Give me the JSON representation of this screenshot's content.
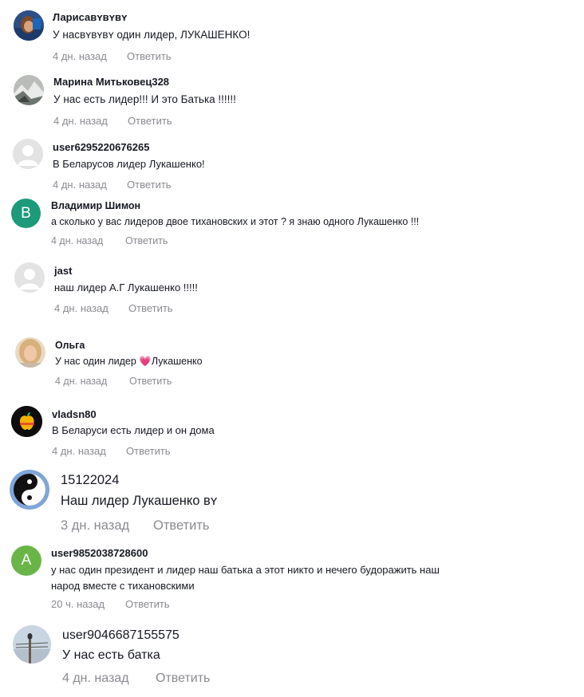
{
  "comments": [
    {
      "username": "Ларисаʙʏʙʏʙʏ",
      "text": "У насʙʏʙʏʙʏ один лидер, ЛУКАШЕНКО!",
      "time": "4 дн. назад",
      "reply": "Ответить",
      "avatar_icon": "user-photo-icon"
    },
    {
      "username": "Марина Митьковец328",
      "text": "У нас есть лидер!!! И это Батька !!!!!!",
      "time": "4 дн. назад",
      "reply": "Ответить",
      "avatar_icon": "landscape-photo-icon"
    },
    {
      "username": "user6295220676265",
      "text": "В Беларусов лидер Лукашенко!",
      "time": "4 дн. назад",
      "reply": "Ответить",
      "avatar_icon": "default-user-icon"
    },
    {
      "username": "Владимир Шимон",
      "text": "а сколько у вас лидеров двое тихановских и этот ? я знаю одного Лукашенко !!!",
      "time": "4 дн. назад",
      "reply": "Ответить",
      "avatar_letter": "В"
    },
    {
      "username": "jast",
      "text": "наш лидер А.Г Лукашенко !!!!!",
      "time": "4 дн. назад",
      "reply": "Ответить",
      "avatar_icon": "default-user-icon"
    },
    {
      "username": "Ольга",
      "text_before": "У нас один лидер ",
      "emoji": "💗",
      "text_after": "Лукашенко",
      "time": "4 дн. назад",
      "reply": "Ответить",
      "avatar_icon": "woman-photo-icon"
    },
    {
      "username": "vladsn80",
      "text": "В Беларуси есть лидер и он дома",
      "time": "4 дн. назад",
      "reply": "Ответить",
      "avatar_icon": "apple-logo-icon"
    },
    {
      "username": "15122024",
      "text": "Наш лидер Лукашенко ʙʏ",
      "time": "3 дн. назад",
      "reply": "Ответить",
      "avatar_icon": "yin-yang-icon"
    },
    {
      "username": "user9852038728600",
      "text_line1": "у нас один президент и лидер наш батька а этот никто и нечего будоражить наш",
      "text_line2": "народ вместе с тихановскими",
      "time": "20 ч. назад",
      "reply": "Ответить",
      "avatar_letter": "A"
    },
    {
      "username": "user9046687155575",
      "text": "У нас есть батка",
      "time": "4 дн. назад",
      "reply": "Ответить",
      "avatar_icon": "bird-photo-icon"
    }
  ]
}
